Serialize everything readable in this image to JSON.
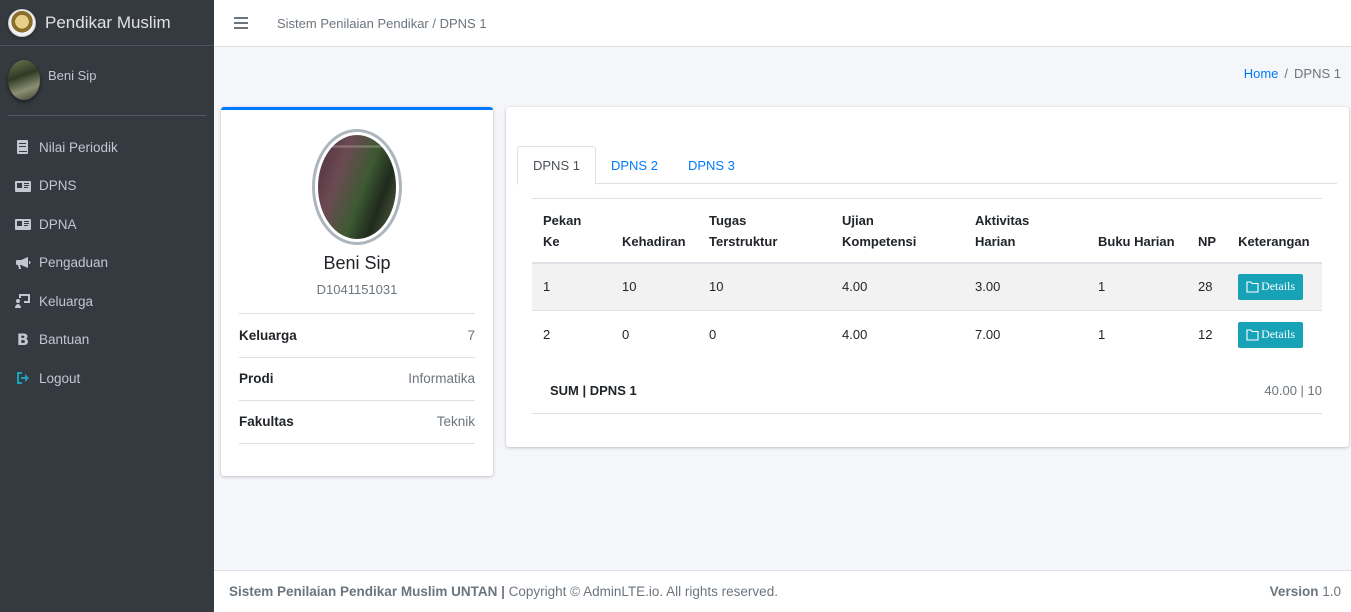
{
  "brand": {
    "name": "Pendikar Muslim",
    "logo_icon": "university-seal-icon"
  },
  "sidebar": {
    "user_name": "Beni Sip",
    "items": [
      {
        "label": "Nilai Periodik",
        "icon": "book-icon"
      },
      {
        "label": "DPNS",
        "icon": "id-card-icon"
      },
      {
        "label": "DPNA",
        "icon": "id-card-icon"
      },
      {
        "label": "Pengaduan",
        "icon": "bullhorn-icon"
      },
      {
        "label": "Keluarga",
        "icon": "chalkboard-user-icon"
      },
      {
        "label": "Bantuan",
        "icon": "bold-b-icon"
      },
      {
        "label": "Logout",
        "icon": "sign-out-icon"
      }
    ]
  },
  "topbar": {
    "title": "Sistem Penilaian Pendikar / DPNS 1"
  },
  "breadcrumb": {
    "home": "Home",
    "separator": "/",
    "current": "DPNS 1"
  },
  "profile": {
    "name": "Beni Sip",
    "id": "D1041151031",
    "items": [
      {
        "key": "Keluarga",
        "value": "7"
      },
      {
        "key": "Prodi",
        "value": "Informatika"
      },
      {
        "key": "Fakultas",
        "value": "Teknik"
      }
    ]
  },
  "tabs": [
    {
      "label": "DPNS 1",
      "active": true
    },
    {
      "label": "DPNS 2",
      "active": false
    },
    {
      "label": "DPNS 3",
      "active": false
    }
  ],
  "table": {
    "headers": {
      "pekan_l1": "Pekan",
      "pekan_l2": "Ke",
      "kehadiran": "Kehadiran",
      "tugas_l1": "Tugas",
      "tugas_l2": "Terstruktur",
      "ujian_l1": "Ujian",
      "ujian_l2": "Kompetensi",
      "aktivitas_l1": "Aktivitas",
      "aktivitas_l2": "Harian",
      "buku": "Buku Harian",
      "np": "NP",
      "keterangan": "Keterangan"
    },
    "rows": [
      {
        "pekan": "1",
        "kehadiran": "10",
        "tugas": "10",
        "ujian": "4.00",
        "aktivitas": "3.00",
        "buku": "1",
        "np": "28",
        "action": "Details"
      },
      {
        "pekan": "2",
        "kehadiran": "0",
        "tugas": "0",
        "ujian": "4.00",
        "aktivitas": "7.00",
        "buku": "1",
        "np": "12",
        "action": "Details"
      }
    ]
  },
  "summary": {
    "label": "SUM | DPNS 1",
    "value": "40.00 | 10"
  },
  "footer": {
    "brand": "Sistem Penilaian Pendikar Muslim UNTAN",
    "separator": "|",
    "copyright": "Copyright © AdminLTE.io. All rights reserved.",
    "version_label": "Version",
    "version": "1.0"
  },
  "colors": {
    "sidebar_bg": "#343a40",
    "primary": "#007bff",
    "info": "#17a2b8",
    "content_bg": "#f4f6f9"
  }
}
